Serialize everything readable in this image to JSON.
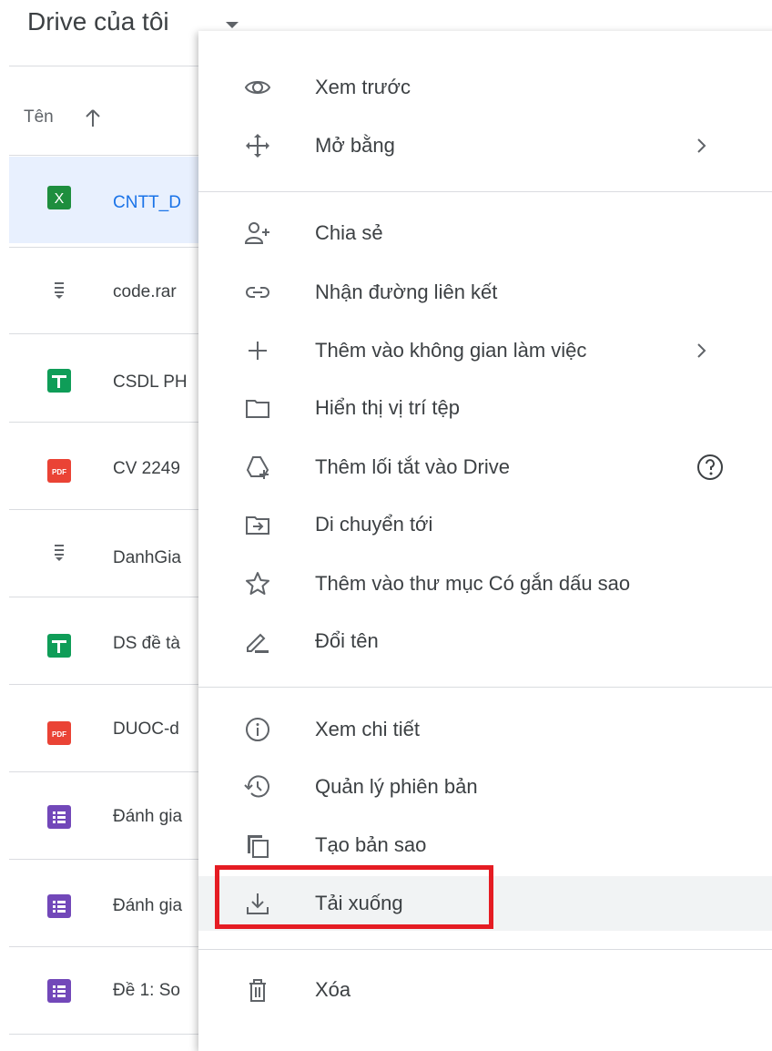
{
  "header": {
    "title": "Drive của tôi",
    "caret_icon": "dropdown-caret-icon"
  },
  "columns": {
    "name_label": "Tên",
    "sort_icon": "arrow-up-icon"
  },
  "files": [
    {
      "icon": "excel-icon",
      "name": "CNTT_D",
      "selected": true
    },
    {
      "icon": "archive-icon",
      "name": "code.rar",
      "selected": false
    },
    {
      "icon": "sheets-icon",
      "name": "CSDL PH",
      "selected": false
    },
    {
      "icon": "pdf-icon",
      "name": "CV 2249",
      "selected": false
    },
    {
      "icon": "archive-icon",
      "name": "DanhGia",
      "selected": false
    },
    {
      "icon": "sheets-icon",
      "name": "DS đề tà",
      "selected": false
    },
    {
      "icon": "pdf-icon",
      "name": "DUOC-d",
      "selected": false
    },
    {
      "icon": "forms-icon",
      "name": "Đánh gia",
      "selected": false
    },
    {
      "icon": "forms-icon",
      "name": "Đánh gia",
      "selected": false
    },
    {
      "icon": "forms-icon",
      "name": "Đề 1: So",
      "selected": false
    }
  ],
  "menu": {
    "items": [
      {
        "label": "Xem trước",
        "icon": "eye-icon"
      },
      {
        "label": "Mở bằng",
        "icon": "move-arrows-icon",
        "has_submenu": true
      },
      {
        "label": "Chia sẻ",
        "icon": "add-person-icon"
      },
      {
        "label": "Nhận đường liên kết",
        "icon": "link-icon"
      },
      {
        "label": "Thêm vào không gian làm việc",
        "icon": "plus-icon",
        "has_submenu": true
      },
      {
        "label": "Hiển thị vị trí tệp",
        "icon": "folder-icon"
      },
      {
        "label": "Thêm lối tắt vào Drive",
        "icon": "drive-shortcut-icon",
        "help": true
      },
      {
        "label": "Di chuyển tới",
        "icon": "move-to-folder-icon"
      },
      {
        "label": "Thêm vào thư mục Có gắn dấu sao",
        "icon": "star-icon"
      },
      {
        "label": "Đổi tên",
        "icon": "pencil-icon"
      },
      {
        "label": "Xem chi tiết",
        "icon": "info-icon"
      },
      {
        "label": "Quản lý phiên bản",
        "icon": "history-icon"
      },
      {
        "label": "Tạo bản sao",
        "icon": "copy-icon"
      },
      {
        "label": "Tải xuống",
        "icon": "download-icon",
        "highlighted": true
      },
      {
        "label": "Xóa",
        "icon": "trash-icon"
      }
    ]
  },
  "colors": {
    "accent": "#1a73e8",
    "highlight_box": "#e51c23",
    "selected_row": "#e8f0fe",
    "hover": "#f1f3f4",
    "excel": "#1e8e3e",
    "sheets": "#0f9d58",
    "pdf": "#ea4335",
    "forms": "#7248b9"
  }
}
